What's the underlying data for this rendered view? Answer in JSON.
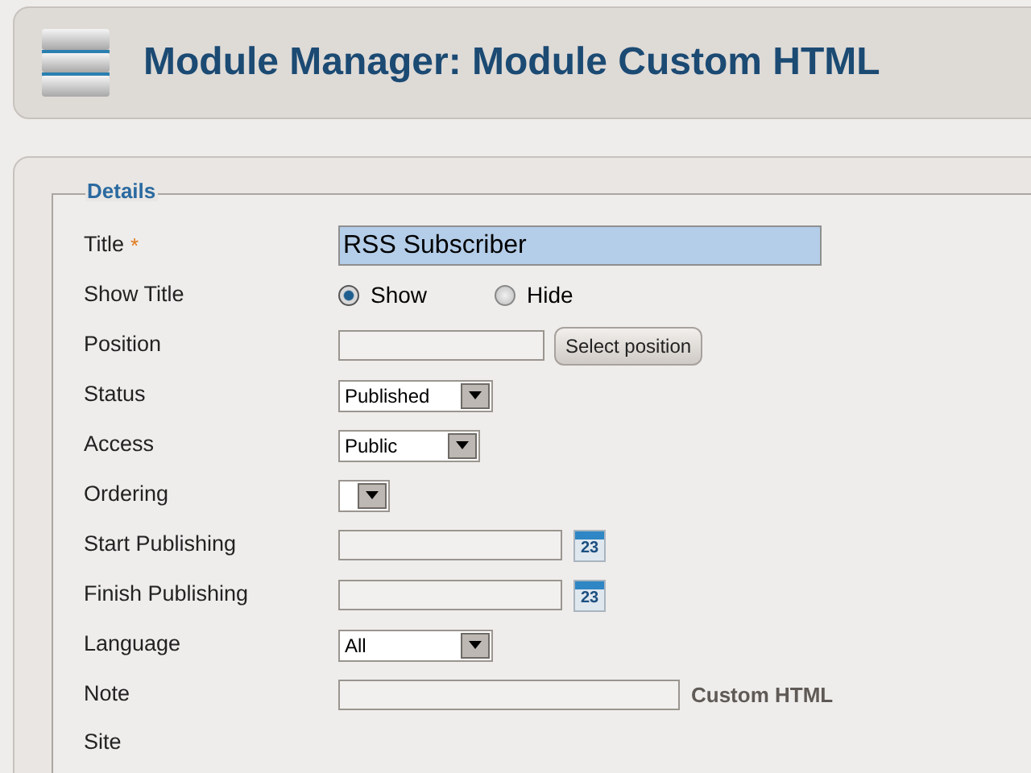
{
  "header": {
    "title": "Module Manager: Module Custom HTML"
  },
  "details": {
    "legend": "Details",
    "rows": [
      {
        "kind": "text",
        "label": "Title",
        "required_mark": "*",
        "value": "RSS Subscriber"
      },
      {
        "kind": "radio",
        "label": "Show Title",
        "options": [
          {
            "label": "Show",
            "selected": true
          },
          {
            "label": "Hide",
            "selected": false
          }
        ]
      },
      {
        "kind": "position",
        "label": "Position",
        "button": "Select position"
      },
      {
        "kind": "select",
        "label": "Status",
        "value": "Published"
      },
      {
        "kind": "select",
        "label": "Access",
        "value": "Public"
      },
      {
        "kind": "select",
        "label": "Ordering"
      },
      {
        "kind": "date",
        "label": "Start Publishing",
        "calendar_day": "23"
      },
      {
        "kind": "date",
        "label": "Finish Publishing",
        "calendar_day": "23"
      },
      {
        "kind": "select",
        "label": "Language",
        "value": "All"
      },
      {
        "kind": "note",
        "label": "Note",
        "suffix": "Custom HTML"
      },
      {
        "kind": "section",
        "label": "Site"
      }
    ]
  }
}
